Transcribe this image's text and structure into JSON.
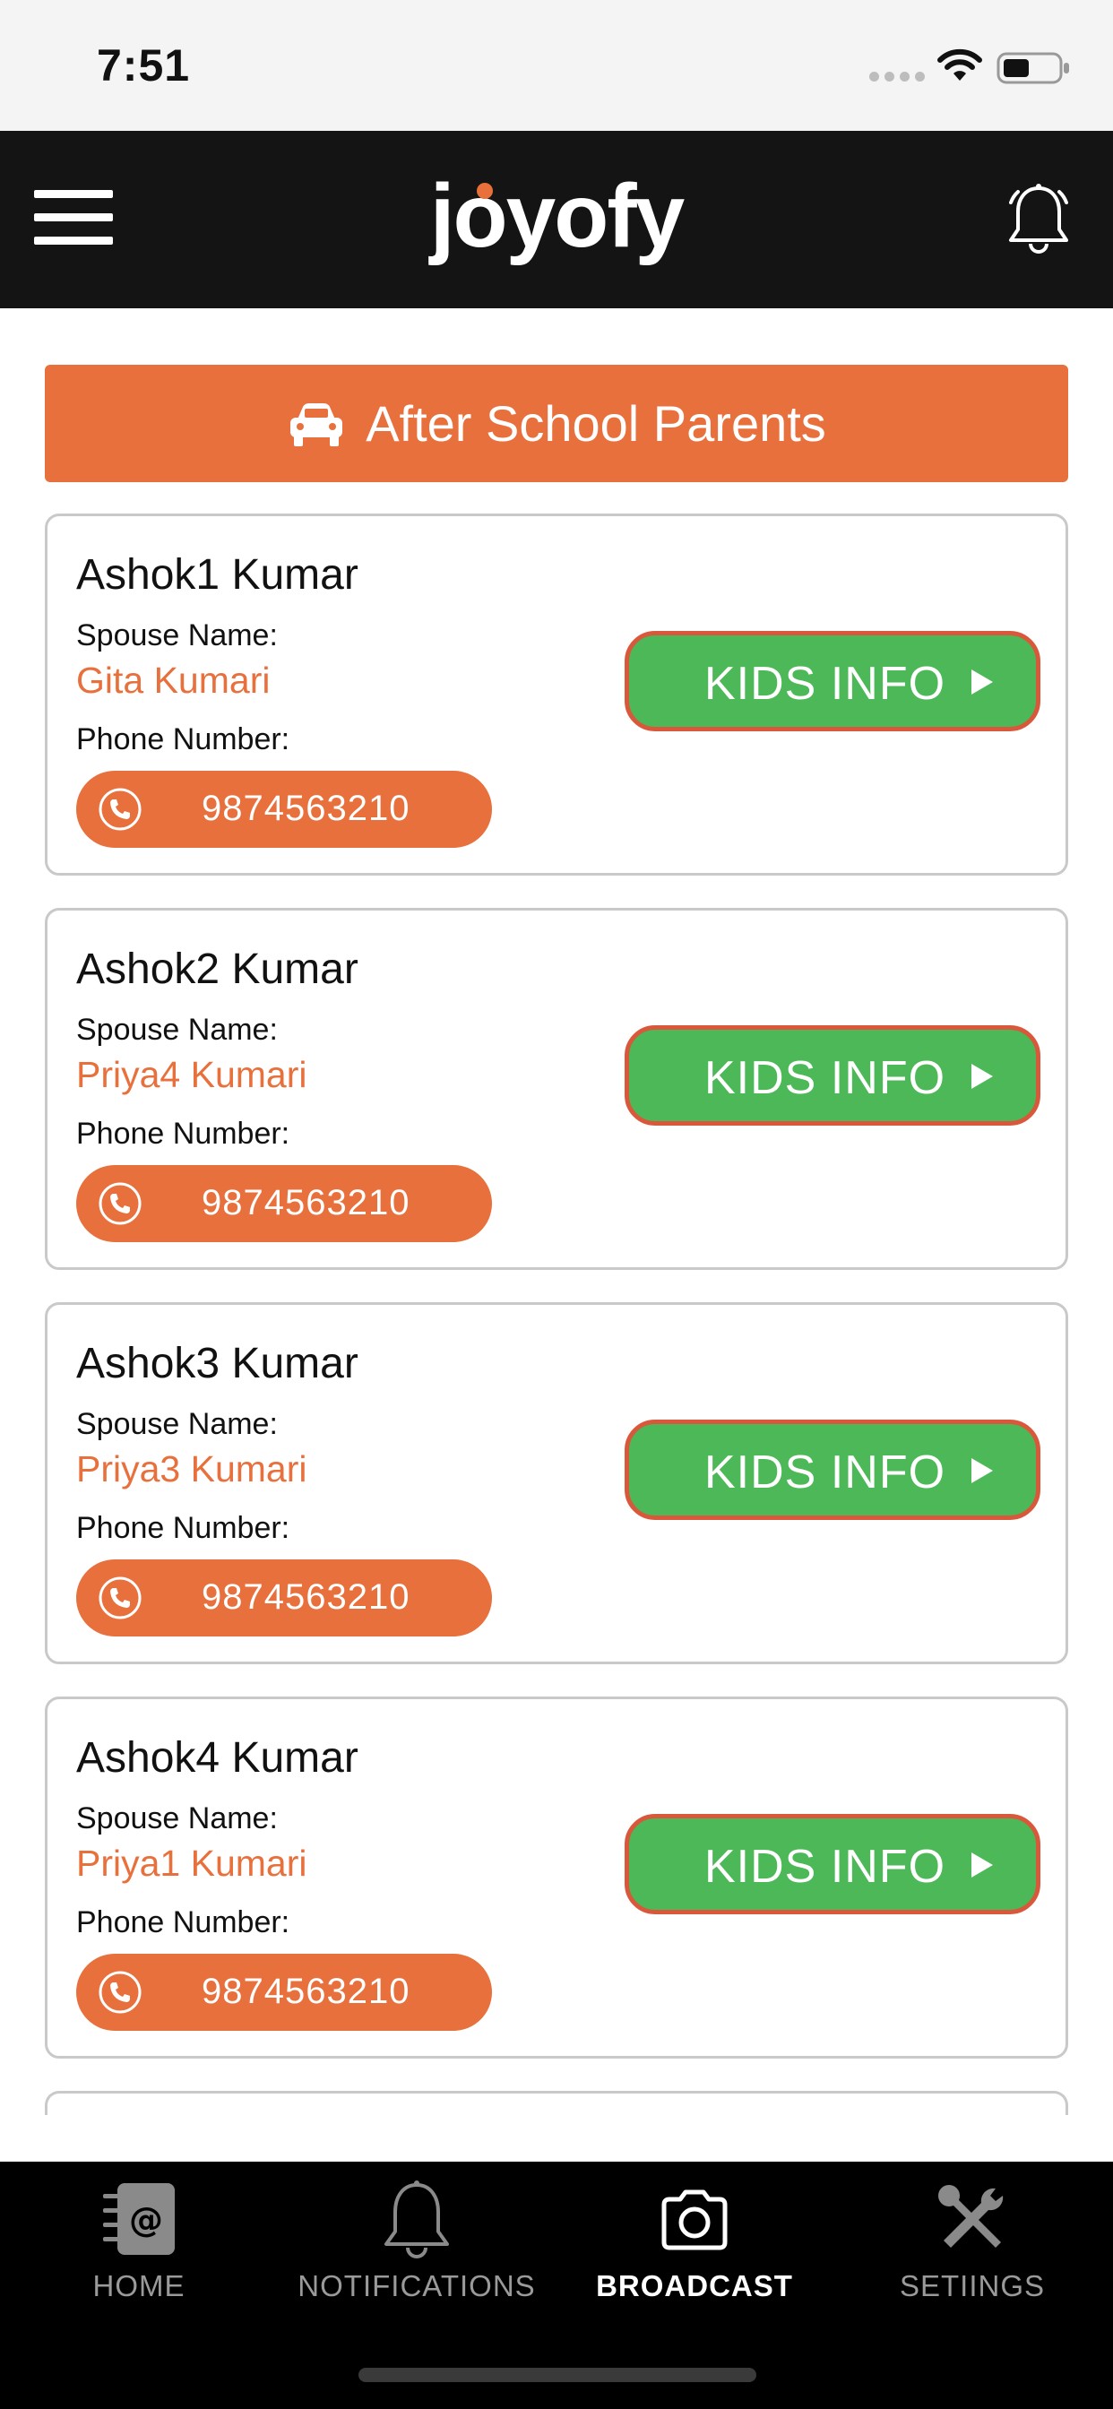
{
  "status_bar": {
    "time": "7:51"
  },
  "header": {
    "app_name": "joyofy"
  },
  "banner": {
    "title": "After School Parents"
  },
  "parents": [
    {
      "name": "Ashok1 Kumar",
      "spouse_label": "Spouse Name:",
      "spouse": "Gita Kumari",
      "phone_label": "Phone Number:",
      "phone": "9874563210",
      "button": "KIDS INFO"
    },
    {
      "name": "Ashok2 Kumar",
      "spouse_label": "Spouse Name:",
      "spouse": "Priya4 Kumari",
      "phone_label": "Phone Number:",
      "phone": "9874563210",
      "button": "KIDS INFO"
    },
    {
      "name": "Ashok3 Kumar",
      "spouse_label": "Spouse Name:",
      "spouse": "Priya3 Kumari",
      "phone_label": "Phone Number:",
      "phone": "9874563210",
      "button": "KIDS INFO"
    },
    {
      "name": "Ashok4 Kumar",
      "spouse_label": "Spouse Name:",
      "spouse": "Priya1 Kumari",
      "phone_label": "Phone Number:",
      "phone": "9874563210",
      "button": "KIDS INFO"
    }
  ],
  "tabs": [
    {
      "label": "HOME",
      "icon": "address-book-icon",
      "active": false
    },
    {
      "label": "NOTIFICATIONS",
      "icon": "bell-icon",
      "active": false
    },
    {
      "label": "BROADCAST",
      "icon": "camera-icon",
      "active": true
    },
    {
      "label": "SETIINGS",
      "icon": "tools-icon",
      "active": false
    }
  ],
  "colors": {
    "accent": "#e8703c",
    "button_green": "#4cb857",
    "header_bg": "#141414"
  }
}
